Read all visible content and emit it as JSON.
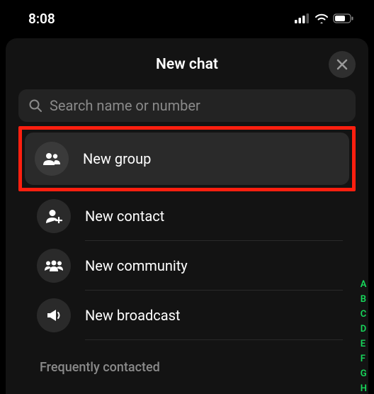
{
  "status": {
    "time": "8:08"
  },
  "sheet": {
    "title": "New chat",
    "search_placeholder": "Search name or number"
  },
  "options": {
    "new_group": "New group",
    "new_contact": "New contact",
    "new_community": "New community",
    "new_broadcast": "New broadcast"
  },
  "sections": {
    "frequently_contacted": "Frequently contacted"
  },
  "alpha_index": [
    "A",
    "B",
    "C",
    "D",
    "E",
    "F",
    "G",
    "H"
  ]
}
